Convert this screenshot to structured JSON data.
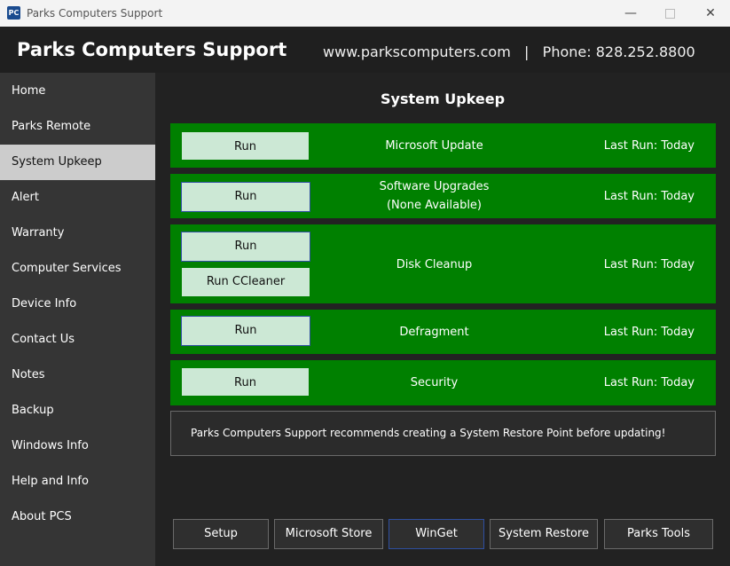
{
  "window": {
    "icon_text": "PC",
    "title": "Parks Computers Support",
    "minimize": "—",
    "close": "✕"
  },
  "header": {
    "brand": "Parks Computers Support",
    "contact": "www.parkscomputers.com   |   Phone: 828.252.8800"
  },
  "sidebar": {
    "items": [
      {
        "label": "Home"
      },
      {
        "label": "Parks Remote"
      },
      {
        "label": "System Upkeep"
      },
      {
        "label": "Alert"
      },
      {
        "label": "Warranty"
      },
      {
        "label": "Computer Services"
      },
      {
        "label": "Device Info"
      },
      {
        "label": "Contact Us"
      },
      {
        "label": "Notes"
      },
      {
        "label": "Backup"
      },
      {
        "label": "Windows Info"
      },
      {
        "label": "Help and Info"
      },
      {
        "label": "About PCS"
      }
    ],
    "active": "System Upkeep"
  },
  "main": {
    "title": "System Upkeep",
    "tasks": [
      {
        "name": "Microsoft Update",
        "run": "Run",
        "last_run": "Last Run: Today"
      },
      {
        "name": "Software Upgrades",
        "sub": "(None Available)",
        "run": "Run",
        "last_run": "Last Run: Today"
      },
      {
        "name": "Disk Cleanup",
        "run": "Run",
        "run2": "Run CCleaner",
        "last_run": "Last Run: Today"
      },
      {
        "name": "Defragment",
        "run": "Run",
        "last_run": "Last Run: Today"
      },
      {
        "name": "Security",
        "run": "Run",
        "last_run": "Last Run: Today"
      }
    ],
    "note": "Parks Computers Support recommends creating a System Restore Point before updating!",
    "bottom_buttons": [
      "Setup",
      "Microsoft Store",
      "WinGet",
      "System Restore",
      "Parks Tools"
    ]
  },
  "colors": {
    "task_green": "#008000",
    "run_button": "#cce8d5",
    "sidebar_active": "#cccccc"
  }
}
